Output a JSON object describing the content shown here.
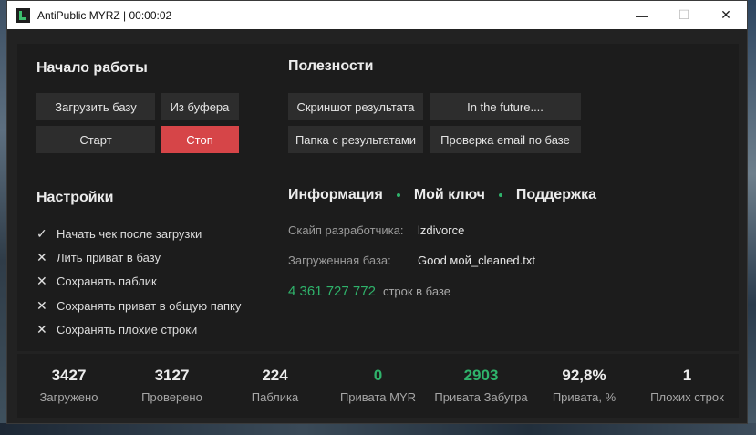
{
  "window": {
    "title": "AntiPublic MYRZ | 00:00:02",
    "minimize_icon": "minimize-icon",
    "maximize_icon": "maximize-icon",
    "close_icon": "close-icon",
    "minimize_glyph": "—",
    "maximize_glyph": "☐",
    "close_glyph": "✕"
  },
  "start": {
    "heading": "Начало работы",
    "load_db": "Загрузить базу",
    "from_clipboard": "Из буфера",
    "start": "Старт",
    "stop": "Стоп",
    "stop_color": "#d64548"
  },
  "utilities": {
    "heading": "Полезности",
    "screenshot": "Скриншот результата",
    "future": "In the future....",
    "results_folder": "Папка с результатами",
    "check_email": "Проверка email по базе"
  },
  "settings": {
    "heading": "Настройки",
    "options": [
      {
        "label": "Начать чек после загрузки",
        "checked": true,
        "mark": "✓"
      },
      {
        "label": "Лить приват в базу",
        "checked": false,
        "mark": "✕"
      },
      {
        "label": "Сохранять паблик",
        "checked": false,
        "mark": "✕"
      },
      {
        "label": "Сохранять приват в общую папку",
        "checked": false,
        "mark": "✕"
      },
      {
        "label": "Сохранять плохие строки",
        "checked": false,
        "mark": "✕"
      }
    ]
  },
  "info": {
    "tab_info": "Информация",
    "tab_key": "Мой ключ",
    "tab_support": "Поддержка",
    "skype_label": "Скайп разработчика:",
    "skype_value": "lzdivorce",
    "db_label": "Загруженная база:",
    "db_value": "Good мой_cleaned.txt",
    "lines_count": "4 361 727 772",
    "lines_caption": "строк в базе",
    "accent_color": "#2fb36b"
  },
  "stats": [
    {
      "value": "3427",
      "caption": "Загружено",
      "highlight": false
    },
    {
      "value": "3127",
      "caption": "Проверено",
      "highlight": false
    },
    {
      "value": "224",
      "caption": "Паблика",
      "highlight": false
    },
    {
      "value": "0",
      "caption": "Привата MYR",
      "highlight": true
    },
    {
      "value": "2903",
      "caption": "Привата Забугра",
      "highlight": true
    },
    {
      "value": "92,8%",
      "caption": "Привата, %",
      "highlight": false
    },
    {
      "value": "1",
      "caption": "Плохих строк",
      "highlight": false
    }
  ]
}
